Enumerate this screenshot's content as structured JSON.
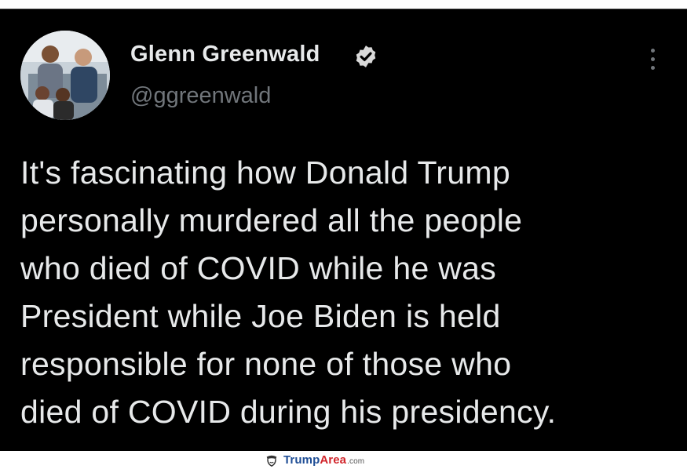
{
  "tweet": {
    "display_name": "Glenn Greenwald",
    "handle": "@ggreenwald",
    "verified": true,
    "text_lines": [
      "It's fascinating how Donald Trump",
      "personally murdered all the people",
      "who died of COVID while he was",
      "President while Joe Biden is held",
      "responsible for none of those who",
      "died of COVID during his presidency."
    ]
  },
  "watermark": {
    "brand_part1": "Trump",
    "brand_part2": "Area",
    "brand_domain": ".com"
  },
  "colors": {
    "background": "#000000",
    "primary_text": "#e7e9ea",
    "secondary_text": "#71767b",
    "watermark_blue": "#1f4e96",
    "watermark_red": "#d1252b"
  },
  "icons": [
    "avatar",
    "verified-badge-icon",
    "more-options-icon",
    "trumparea-logo-icon"
  ]
}
